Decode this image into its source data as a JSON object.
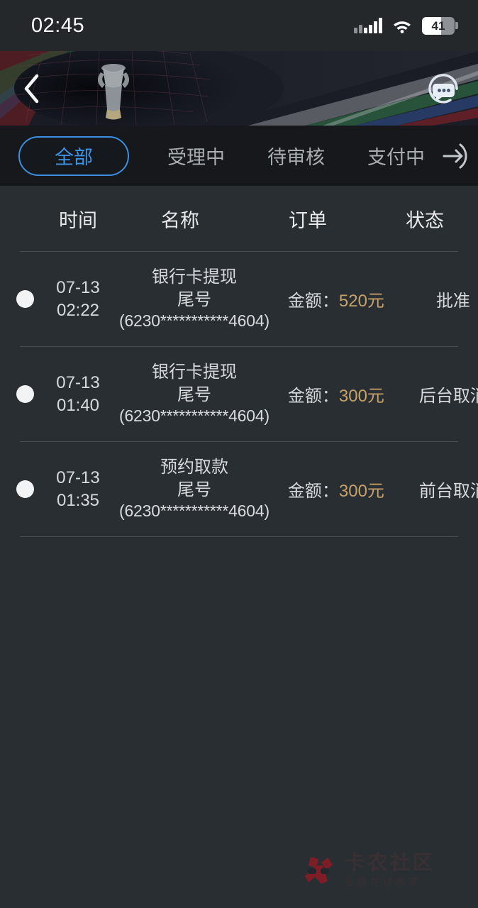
{
  "statusbar": {
    "time": "02:45",
    "battery_level": "41",
    "signal_icon": "signal-bars-icon",
    "wifi_icon": "wifi-icon",
    "battery_icon": "battery-icon"
  },
  "banner": {
    "back_icon": "chevron-left-icon",
    "chat_icon": "customer-service-chat-icon"
  },
  "tabs": {
    "items": [
      {
        "label": "全部",
        "active": true
      },
      {
        "label": "受理中",
        "active": false
      },
      {
        "label": "待审核",
        "active": false
      },
      {
        "label": "支付中",
        "active": false
      }
    ],
    "overflow_icon": "arrow-right-icon"
  },
  "table": {
    "headers": [
      "时间",
      "名称",
      "订单",
      "状态"
    ],
    "rows": [
      {
        "marker": "status-dot",
        "date": "07-13",
        "time": "02:22",
        "name": "银行卡提现",
        "card_label": "尾号",
        "card_mask": "(6230***********4604)",
        "amount_label": "金额：",
        "amount": "520元",
        "status": "批准"
      },
      {
        "marker": "status-dot",
        "date": "07-13",
        "time": "01:40",
        "name": "银行卡提现",
        "card_label": "尾号",
        "card_mask": "(6230***********4604)",
        "amount_label": "金额：",
        "amount": "300元",
        "status": "后台取消"
      },
      {
        "marker": "status-dot",
        "date": "07-13",
        "time": "01:35",
        "name": "预约取款",
        "card_label": "尾号",
        "card_mask": "(6230***********4604)",
        "amount_label": "金额：",
        "amount": "300元",
        "status": "前台取消"
      }
    ]
  },
  "watermark": {
    "title": "卡农社区",
    "subtitle": "金融在线教育",
    "logo_icon": "kanong-logo-icon"
  },
  "colors": {
    "accent_blue": "#3b8fe0",
    "amount_gold": "#c6a268",
    "page_bg": "#292e32",
    "tabbar_bg": "#16181b",
    "statusbar_bg": "#24282b",
    "divider": "#474d52",
    "watermark_red": "#8f1b24"
  }
}
